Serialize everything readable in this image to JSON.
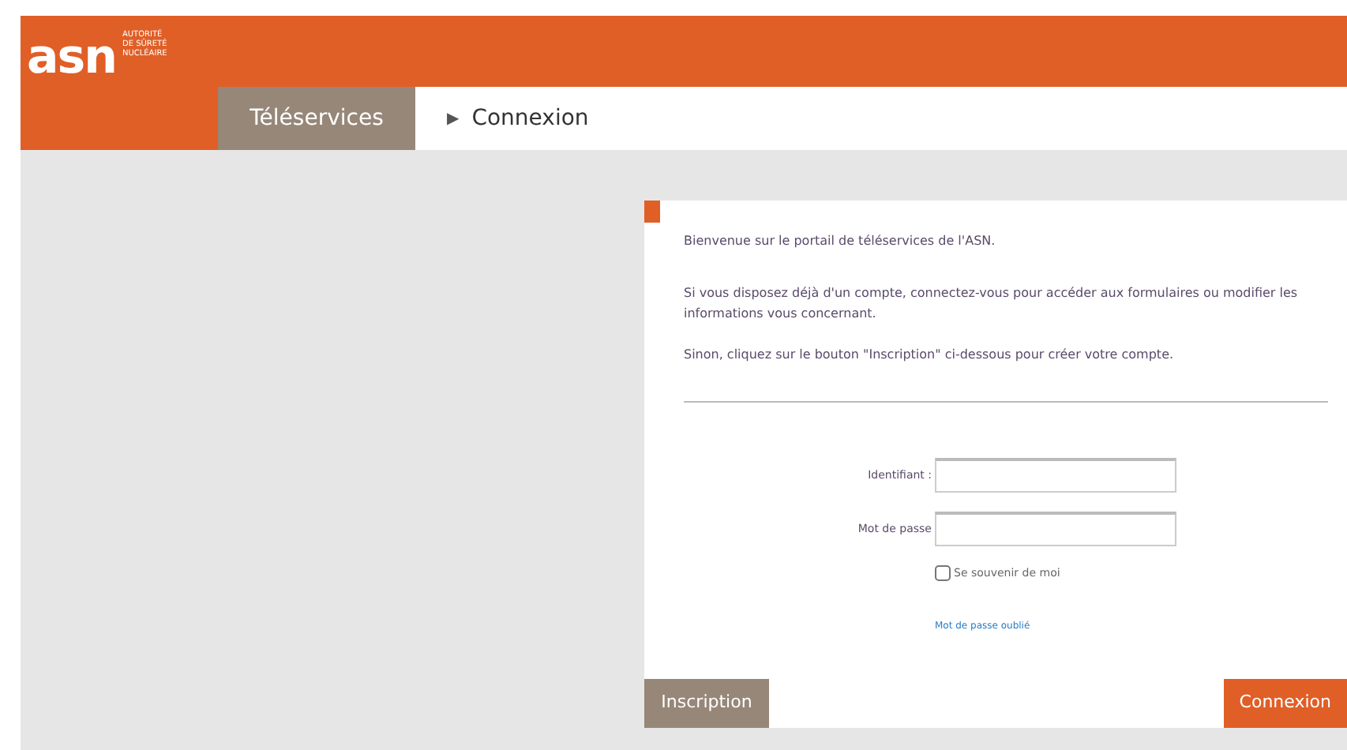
{
  "header": {
    "logo": {
      "text": "asn",
      "tagline": [
        "AUTORITÉ",
        "DE SÛRETÉ",
        "NUCLÉAIRE"
      ]
    },
    "tab": {
      "label": "Téléservices",
      "selected": true
    },
    "breadcrumb": {
      "separator": "▶",
      "label": "Connexion"
    }
  },
  "panel": {
    "paragraphs": [
      "Bienvenue sur le portail de téléservices de l'ASN.",
      "Si vous disposez déjà d'un compte, connectez-vous pour accéder aux formulaires ou modifier les informations vous concernant.",
      "Sinon, cliquez sur le bouton \"Inscription\" ci-dessous pour créer votre compte."
    ],
    "fields": [
      {
        "label": "Identifiant :"
      },
      {
        "label": "Mot de passe"
      }
    ],
    "remember": {
      "label": "Se souvenir de moi",
      "checked": false
    },
    "forgot_link": "Mot de passe oublié",
    "buttons": [
      {
        "label": "Inscription",
        "kind": "secondary"
      },
      {
        "label": "Connexion",
        "kind": "primary"
      }
    ]
  }
}
